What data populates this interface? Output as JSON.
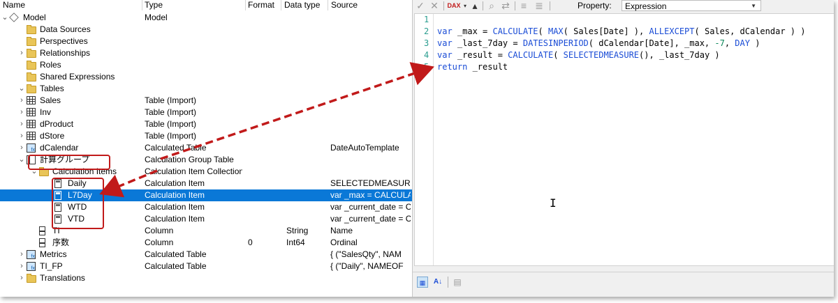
{
  "tree": {
    "columns": {
      "name": "Name",
      "type": "Type",
      "format": "Format",
      "datatype": "Data type",
      "source": "Source"
    },
    "rows": [
      {
        "name": "Model",
        "type": "Model",
        "format": "",
        "datatype": "",
        "source": "",
        "icon": "cube-icon",
        "arrow": "⌄"
      },
      {
        "name": "Data Sources",
        "type": "",
        "format": "",
        "datatype": "",
        "source": "",
        "icon": "folder-icon",
        "arrow": ""
      },
      {
        "name": "Perspectives",
        "type": "",
        "format": "",
        "datatype": "",
        "source": "",
        "icon": "folder-icon",
        "arrow": ""
      },
      {
        "name": "Relationships",
        "type": "",
        "format": "",
        "datatype": "",
        "source": "",
        "icon": "folder-icon",
        "arrow": "›"
      },
      {
        "name": "Roles",
        "type": "",
        "format": "",
        "datatype": "",
        "source": "",
        "icon": "folder-icon",
        "arrow": ""
      },
      {
        "name": "Shared Expressions",
        "type": "",
        "format": "",
        "datatype": "",
        "source": "",
        "icon": "folder-icon",
        "arrow": ""
      },
      {
        "name": "Tables",
        "type": "",
        "format": "",
        "datatype": "",
        "source": "",
        "icon": "folder-open-icon",
        "arrow": "⌄"
      },
      {
        "name": "Sales",
        "type": "Table (Import)",
        "format": "",
        "datatype": "",
        "source": "",
        "icon": "table-icon",
        "arrow": "›"
      },
      {
        "name": "Inv",
        "type": "Table (Import)",
        "format": "",
        "datatype": "",
        "source": "",
        "icon": "table-icon",
        "arrow": "›"
      },
      {
        "name": "dProduct",
        "type": "Table (Import)",
        "format": "",
        "datatype": "",
        "source": "",
        "icon": "table-icon",
        "arrow": "›"
      },
      {
        "name": "dStore",
        "type": "Table (Import)",
        "format": "",
        "datatype": "",
        "source": "",
        "icon": "table-icon",
        "arrow": "›"
      },
      {
        "name": "dCalendar",
        "type": "Calculated Table",
        "format": "",
        "datatype": "",
        "source": "DateAutoTemplate",
        "icon": "calculated-table-icon",
        "arrow": "›"
      },
      {
        "name": "計算グループ",
        "type": "Calculation Group Table",
        "format": "",
        "datatype": "",
        "source": "",
        "icon": "calculation-group-icon",
        "arrow": "⌄"
      },
      {
        "name": "Calculation Items",
        "type": "Calculation Item Collection",
        "format": "",
        "datatype": "",
        "source": "",
        "icon": "folder-open-icon",
        "arrow": "⌄"
      },
      {
        "name": "Daily",
        "type": "Calculation Item",
        "format": "",
        "datatype": "",
        "source": "SELECTEDMEASUR",
        "icon": "calculation-item-icon",
        "arrow": ""
      },
      {
        "name": "L7Day",
        "type": "Calculation Item",
        "format": "",
        "datatype": "",
        "source": "var _max = CALCULA",
        "icon": "calculation-item-icon",
        "arrow": "",
        "selected": true
      },
      {
        "name": "WTD",
        "type": "Calculation Item",
        "format": "",
        "datatype": "",
        "source": "var _current_date = C",
        "icon": "calculation-item-icon",
        "arrow": ""
      },
      {
        "name": "VTD",
        "type": "Calculation Item",
        "format": "",
        "datatype": "",
        "source": "var _current_date = C",
        "icon": "calculation-item-icon",
        "arrow": ""
      },
      {
        "name": "TI",
        "type": "Column",
        "format": "",
        "datatype": "String",
        "source": "Name",
        "icon": "column-icon",
        "arrow": ""
      },
      {
        "name": "序数",
        "type": "Column",
        "format": "0",
        "datatype": "Int64",
        "source": "Ordinal",
        "icon": "column-icon",
        "arrow": ""
      },
      {
        "name": "Metrics",
        "type": "Calculated Table",
        "format": "",
        "datatype": "",
        "source": "{    (\"SalesQty\", NAM",
        "icon": "calculated-table-icon",
        "arrow": "›"
      },
      {
        "name": "TI_FP",
        "type": "Calculated Table",
        "format": "",
        "datatype": "",
        "source": "{    (\"Daily\", NAMEOF",
        "icon": "calculated-table-icon",
        "arrow": "›"
      },
      {
        "name": "Translations",
        "type": "",
        "format": "",
        "datatype": "",
        "source": "",
        "icon": "folder-icon",
        "arrow": "›"
      }
    ]
  },
  "toolbar": {
    "property_label": "Property:",
    "property_value": "Expression",
    "buttons": [
      "accept-icon",
      "cancel-icon",
      "dax-format-icon",
      "dropdown-icon",
      "deploy-icon",
      "find-icon",
      "replace-icon",
      "indent-icon",
      "outdent-icon"
    ]
  },
  "editor": {
    "line_numbers": [
      "1",
      "2",
      "3",
      "4",
      "5"
    ],
    "lines": [
      "",
      "var _max = CALCULATE( MAX( Sales[Date] ), ALLEXCEPT( Sales, dCalendar ) )",
      "var _last_7day = DATESINPERIOD( dCalendar[Date], _max, -7, DAY )",
      "var _result = CALCULATE( SELECTEDMEASURE(), _last_7day )",
      "return _result"
    ],
    "ibeam": "I"
  },
  "colors": {
    "selection": "#0a78d7",
    "highlight": "#c11a1a",
    "keyword": "#1a4cd6",
    "line_number": "#2a9d8f"
  }
}
